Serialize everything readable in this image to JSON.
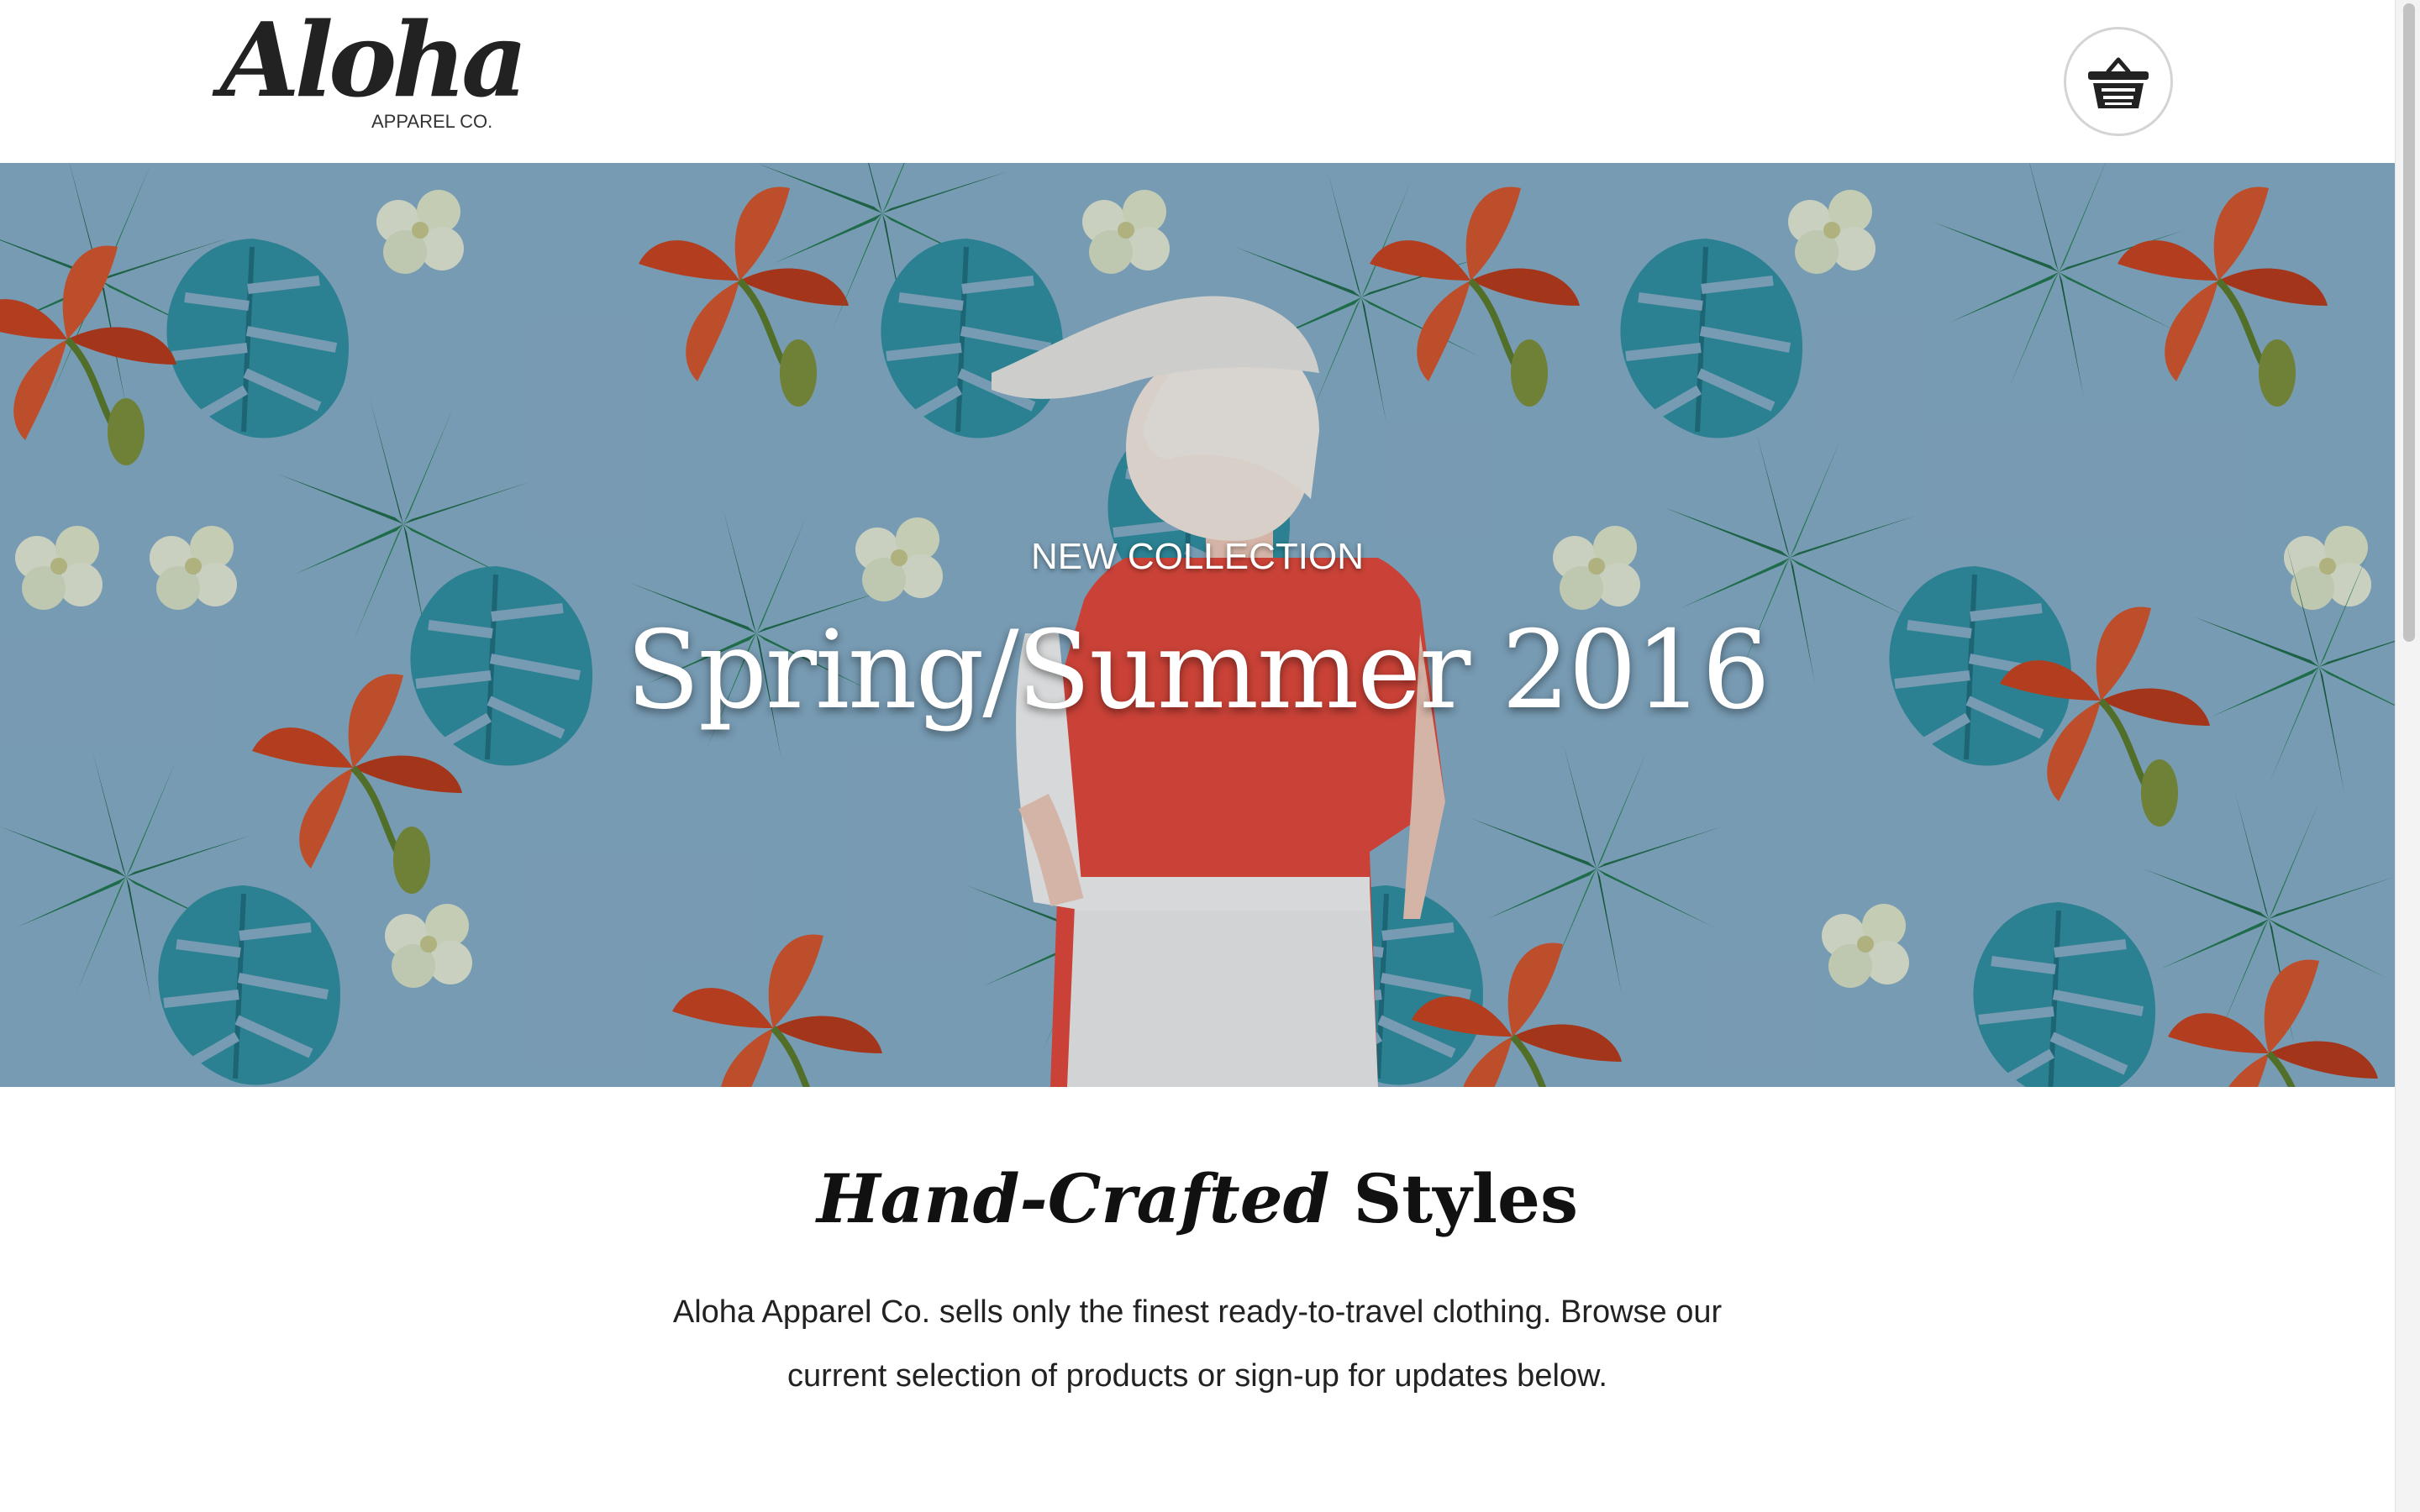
{
  "header": {
    "logo_script": "Aloha",
    "logo_subtitle": "APPAREL CO.",
    "cart_icon": "shopping-basket-icon"
  },
  "hero": {
    "kicker": "NEW COLLECTION",
    "title": "Spring/Summer 2016"
  },
  "intro": {
    "heading_italic": "Hand-Crafted",
    "heading_bold": "Styles",
    "text": "Aloha Apparel Co. sells only the finest ready-to-travel clothing. Browse our current selection of products or sign-up for updates below."
  },
  "colors": {
    "hero_background": "#86acc6",
    "leaf_dark": "#1f6b4a",
    "leaf_teal": "#2f8fa0",
    "flower_red": "#c9421e",
    "flower_cream": "#e4e9d4",
    "shirt_red": "#e4473a"
  }
}
